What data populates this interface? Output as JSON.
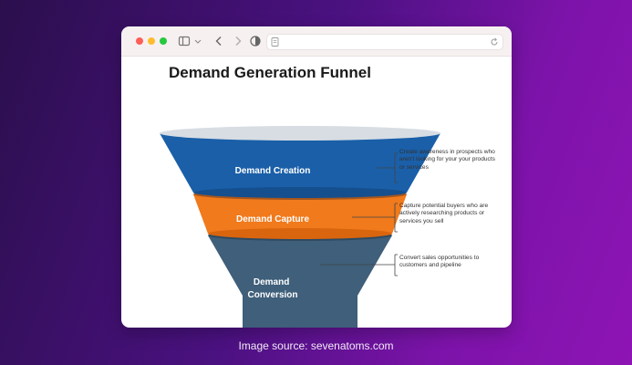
{
  "diagram": {
    "title": "Demand Generation Funnel",
    "stages": [
      {
        "label_lines": [
          "Demand Creation"
        ],
        "color": "#1a5fa8",
        "description": "Create awareness in prospects who aren't looking for your your products or services"
      },
      {
        "label_lines": [
          "Demand Capture"
        ],
        "color": "#f07a1c",
        "description": "Capture potential buyers who are actively researching products or services you sell"
      },
      {
        "label_lines": [
          "Demand",
          "Conversion"
        ],
        "color": "#3f5f7a",
        "description": "Convert sales opportunities to customers and pipeline"
      }
    ]
  },
  "caption": "Image source: sevenatoms.com",
  "colors": {
    "background_start": "#2b0f4d",
    "background_end": "#8e14b4",
    "window": "#ffffff",
    "toolbar": "#f6f1f0"
  },
  "icons": [
    "sidebar-icon",
    "chevron-down-icon",
    "back-arrow-icon",
    "forward-arrow-icon",
    "shield-icon",
    "page-icon",
    "reload-icon"
  ]
}
